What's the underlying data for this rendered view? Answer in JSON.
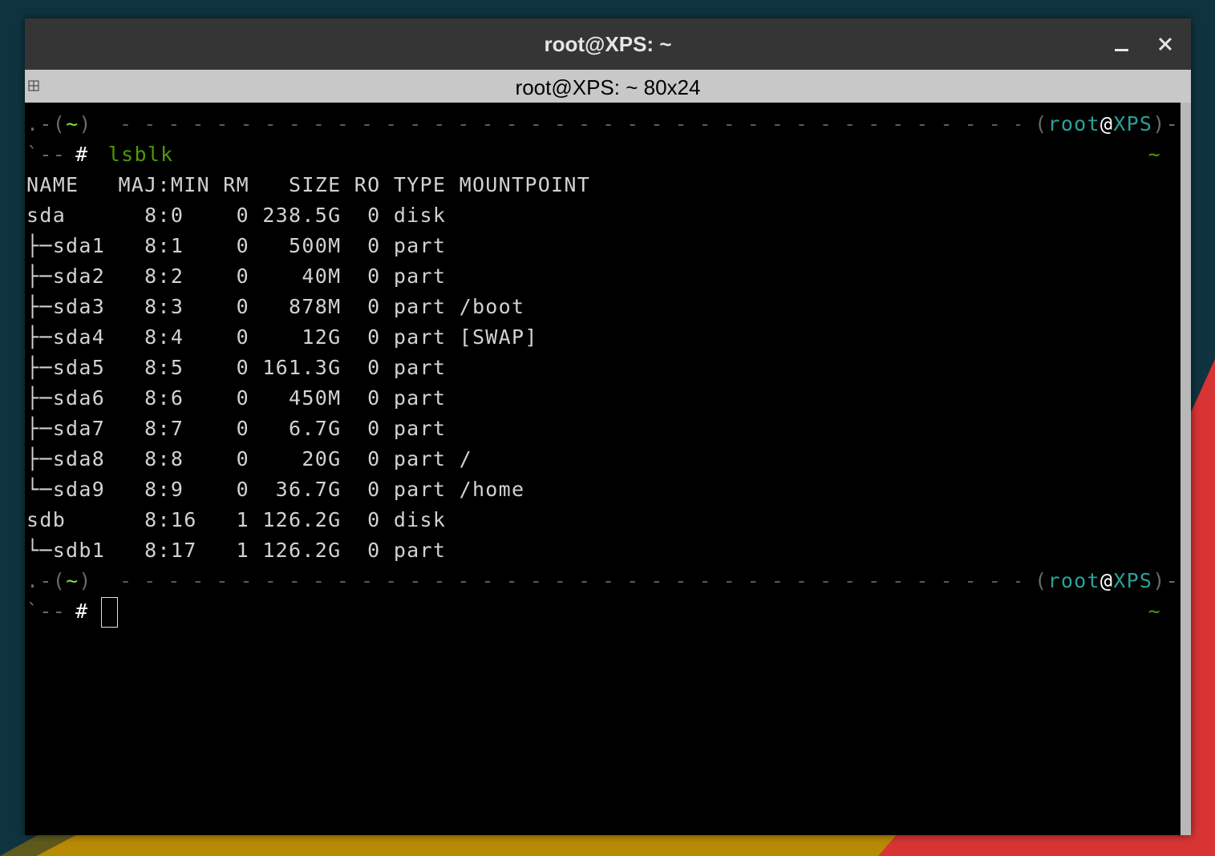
{
  "window": {
    "title": "root@XPS: ~",
    "tab_title": "root@XPS: ~ 80x24"
  },
  "colors": {
    "titlebar": "#353535",
    "tabbar": "#c8c8c8",
    "terminal_bg": "#000000",
    "prompt_green": "#4e9a06",
    "prompt_cyan": "#2aa198"
  },
  "prompt": {
    "dir": "~",
    "user": "root",
    "at": "@",
    "host": "XPS",
    "symbol": "#",
    "right_dir": "~"
  },
  "command": "lsblk",
  "table": {
    "header": "NAME   MAJ:MIN RM   SIZE RO TYPE MOUNTPOINT",
    "rows": [
      "sda      8:0    0 238.5G  0 disk ",
      "├─sda1   8:1    0   500M  0 part ",
      "├─sda2   8:2    0    40M  0 part ",
      "├─sda3   8:3    0   878M  0 part /boot",
      "├─sda4   8:4    0    12G  0 part [SWAP]",
      "├─sda5   8:5    0 161.3G  0 part ",
      "├─sda6   8:6    0   450M  0 part ",
      "├─sda7   8:7    0   6.7G  0 part ",
      "├─sda8   8:8    0    20G  0 part /",
      "└─sda9   8:9    0  36.7G  0 part /home",
      "sdb      8:16   1 126.2G  0 disk ",
      "└─sdb1   8:17   1 126.2G  0 part "
    ]
  },
  "icons": {
    "tab_icon": "split-terminal-icon",
    "minimize": "minimize-icon",
    "close": "close-icon"
  }
}
